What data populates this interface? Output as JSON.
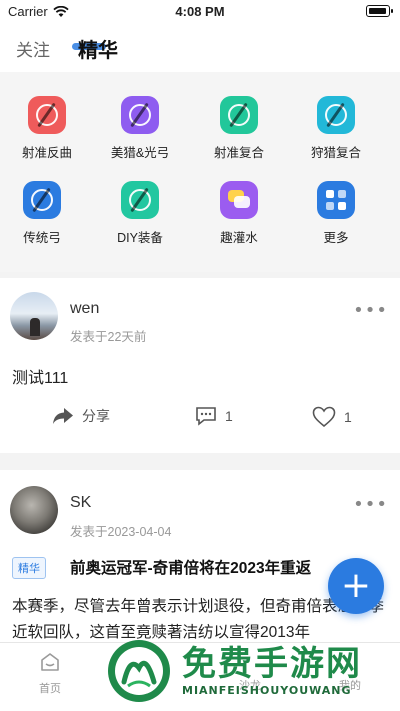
{
  "status_bar": {
    "carrier": "Carrier",
    "time": "4:08 PM"
  },
  "top_tabs": {
    "follow": "关注",
    "featured": "精华"
  },
  "categories": [
    {
      "label": "射准反曲",
      "icon": "recurve-bow-icon",
      "color": "#ef5b5b"
    },
    {
      "label": "美猎&光弓",
      "icon": "longbow-icon",
      "color": "#8e5cf0"
    },
    {
      "label": "射准复合",
      "icon": "compound-bow-icon",
      "color": "#22c79a"
    },
    {
      "label": "狩猎复合",
      "icon": "hunting-compound-icon",
      "color": "#22b8d8"
    },
    {
      "label": "传统弓",
      "icon": "traditional-bow-icon",
      "color": "#2b7be0"
    },
    {
      "label": "DIY装备",
      "icon": "diy-gear-icon",
      "color": "#22c7a0"
    },
    {
      "label": "趣灌水",
      "icon": "chat-bubbles-icon",
      "color": "#9b5cf0"
    },
    {
      "label": "更多",
      "icon": "more-grid-icon",
      "color": "#2b7be0"
    }
  ],
  "posts": [
    {
      "user": "wen",
      "time": "发表于22天前",
      "text": "测试111",
      "share_label": "分享",
      "comments": "1",
      "likes": "1"
    },
    {
      "user": "SK",
      "time": "发表于2023-04-04",
      "badge": "精华",
      "title": "前奥运冠军-奇甫倍将在2023年重返",
      "body": "本赛季，尽管去年曾表示计划退役，但奇甫倍表态外季近软回队，这首至竟赎著洁纺以宣得2013年"
    }
  ],
  "bottom_nav": {
    "home": "首页",
    "salon": "沙龙",
    "mine": "我的"
  },
  "watermark": {
    "title": "免费手游网",
    "subtitle": "MIANFEISHOUYOUWANG"
  },
  "colors": {
    "accent": "#2b7be0",
    "watermark": "#1f8a4a"
  }
}
